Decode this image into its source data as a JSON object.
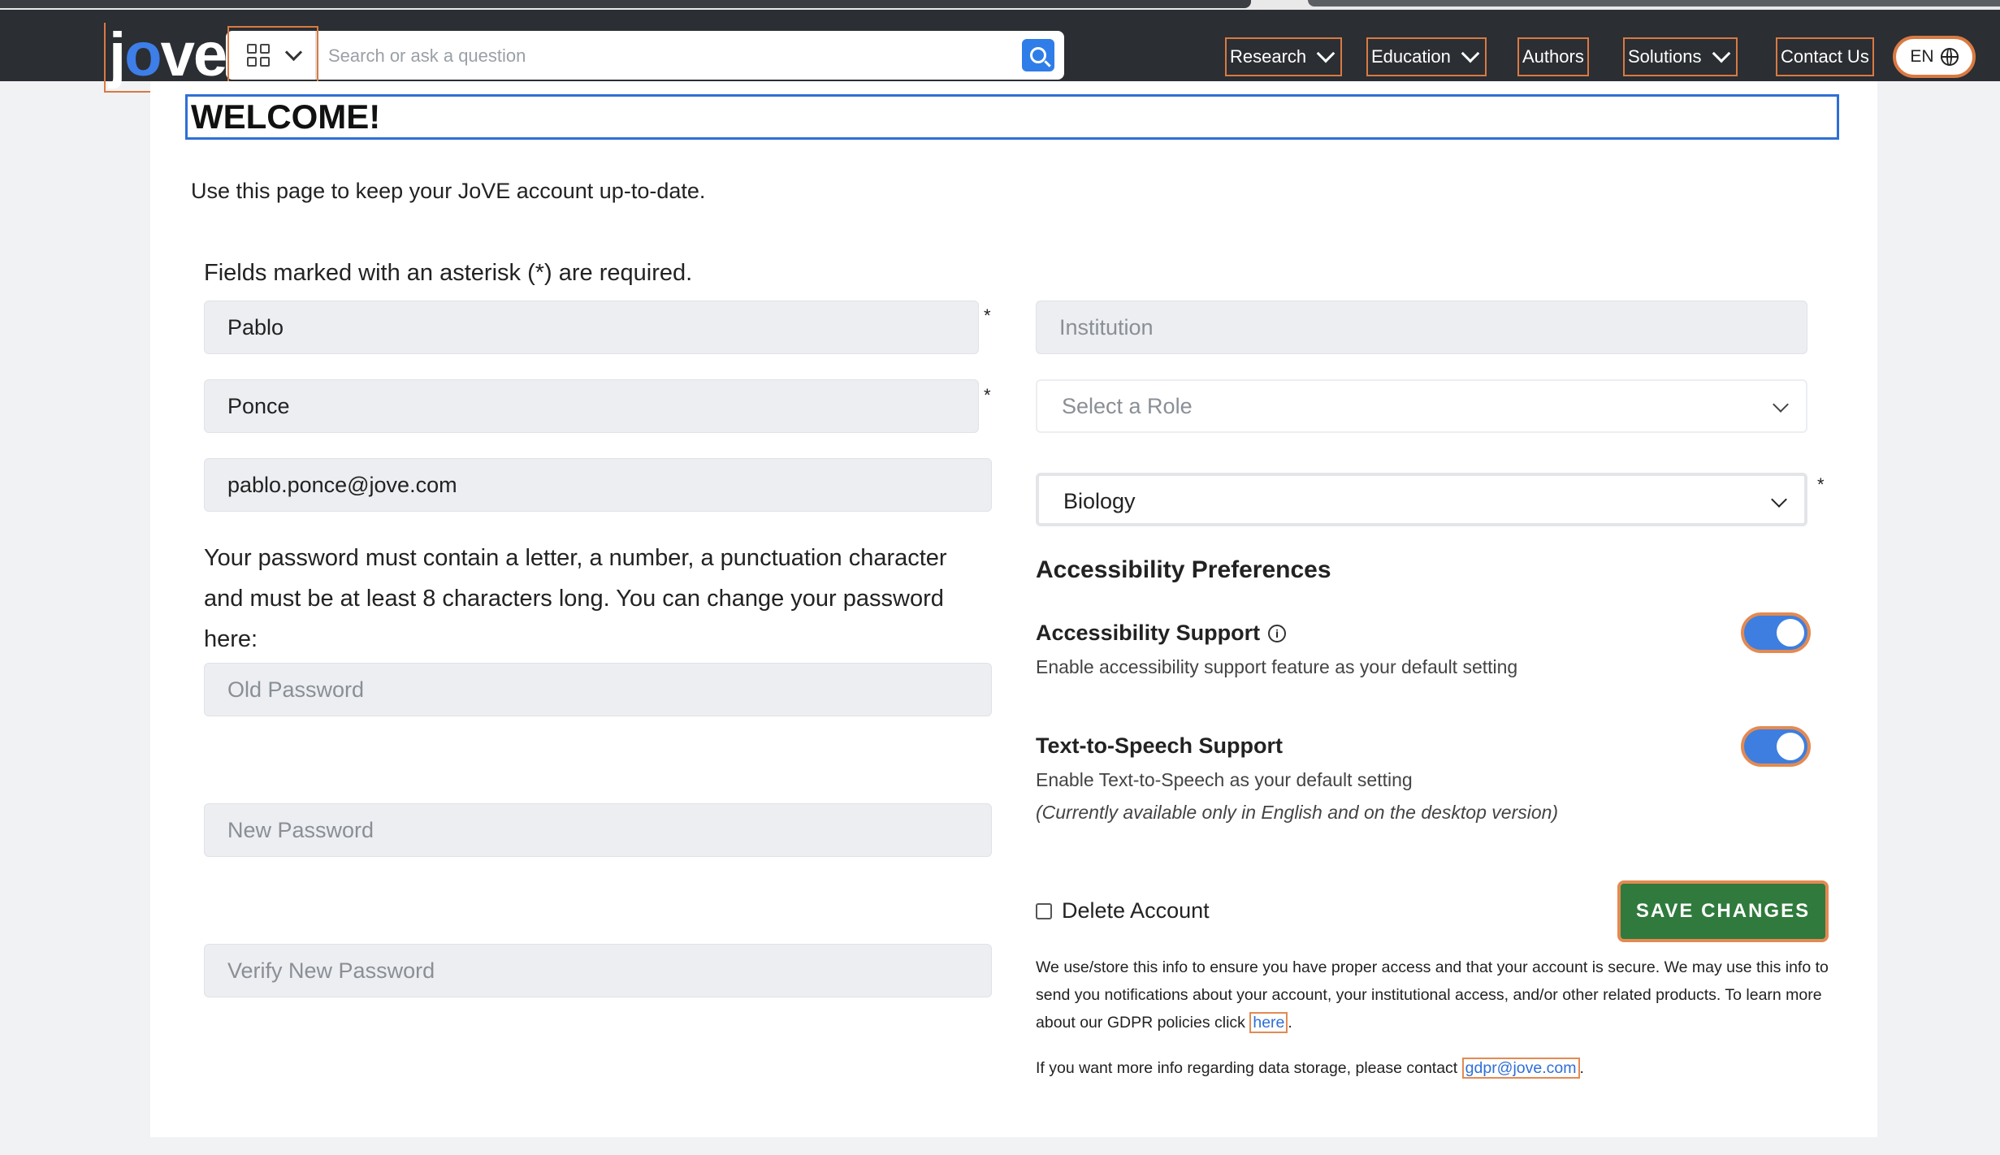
{
  "header": {
    "logo": "jove",
    "search_placeholder": "Search or ask a question",
    "nav": [
      "Research",
      "Education",
      "Authors",
      "Solutions",
      "Contact Us"
    ],
    "language": "EN"
  },
  "page": {
    "title": "WELCOME!",
    "intro": "Use this page to keep your JoVE account up-to-date.",
    "required_note": "Fields marked with an asterisk (*) are required."
  },
  "form": {
    "first_name": "Pablo",
    "last_name": "Ponce",
    "email": "pablo.ponce@jove.com",
    "institution_placeholder": "Institution",
    "role_placeholder": "Select a Role",
    "field_selected": "Biology",
    "password_note": "Your password must contain a letter, a number, a punctuation character and must be at least 8 characters long. You can change your password here:",
    "old_password_placeholder": "Old Password",
    "new_password_placeholder": "New Password",
    "verify_password_placeholder": "Verify New Password",
    "asterisk": "*"
  },
  "accessibility": {
    "title": "Accessibility Preferences",
    "support_title": "Accessibility Support",
    "support_desc": "Enable accessibility support feature as your default setting",
    "support_on": true,
    "tts_title": "Text-to-Speech Support",
    "tts_desc": "Enable Text-to-Speech as your default setting",
    "tts_note": "(Currently available only in English and on the desktop version)",
    "tts_on": true
  },
  "actions": {
    "delete_label": "Delete Account",
    "save_label": "SAVE CHANGES"
  },
  "footer_text": {
    "gdpr_text": "We use/store this info to ensure you have proper access and that your account is secure. We may use this info to send you notifications about your account, your institutional access, and/or other related products. To learn more about our GDPR policies click",
    "gdpr_link": "here",
    "contact_text": "If you want more info regarding data storage, please contact",
    "contact_email": "gdpr@jove.com"
  },
  "colors": {
    "topbar": "#2b2e33",
    "accent_blue": "#2f7de8",
    "save_green": "#2f7a3c",
    "focus_outline": "#e38a52"
  }
}
